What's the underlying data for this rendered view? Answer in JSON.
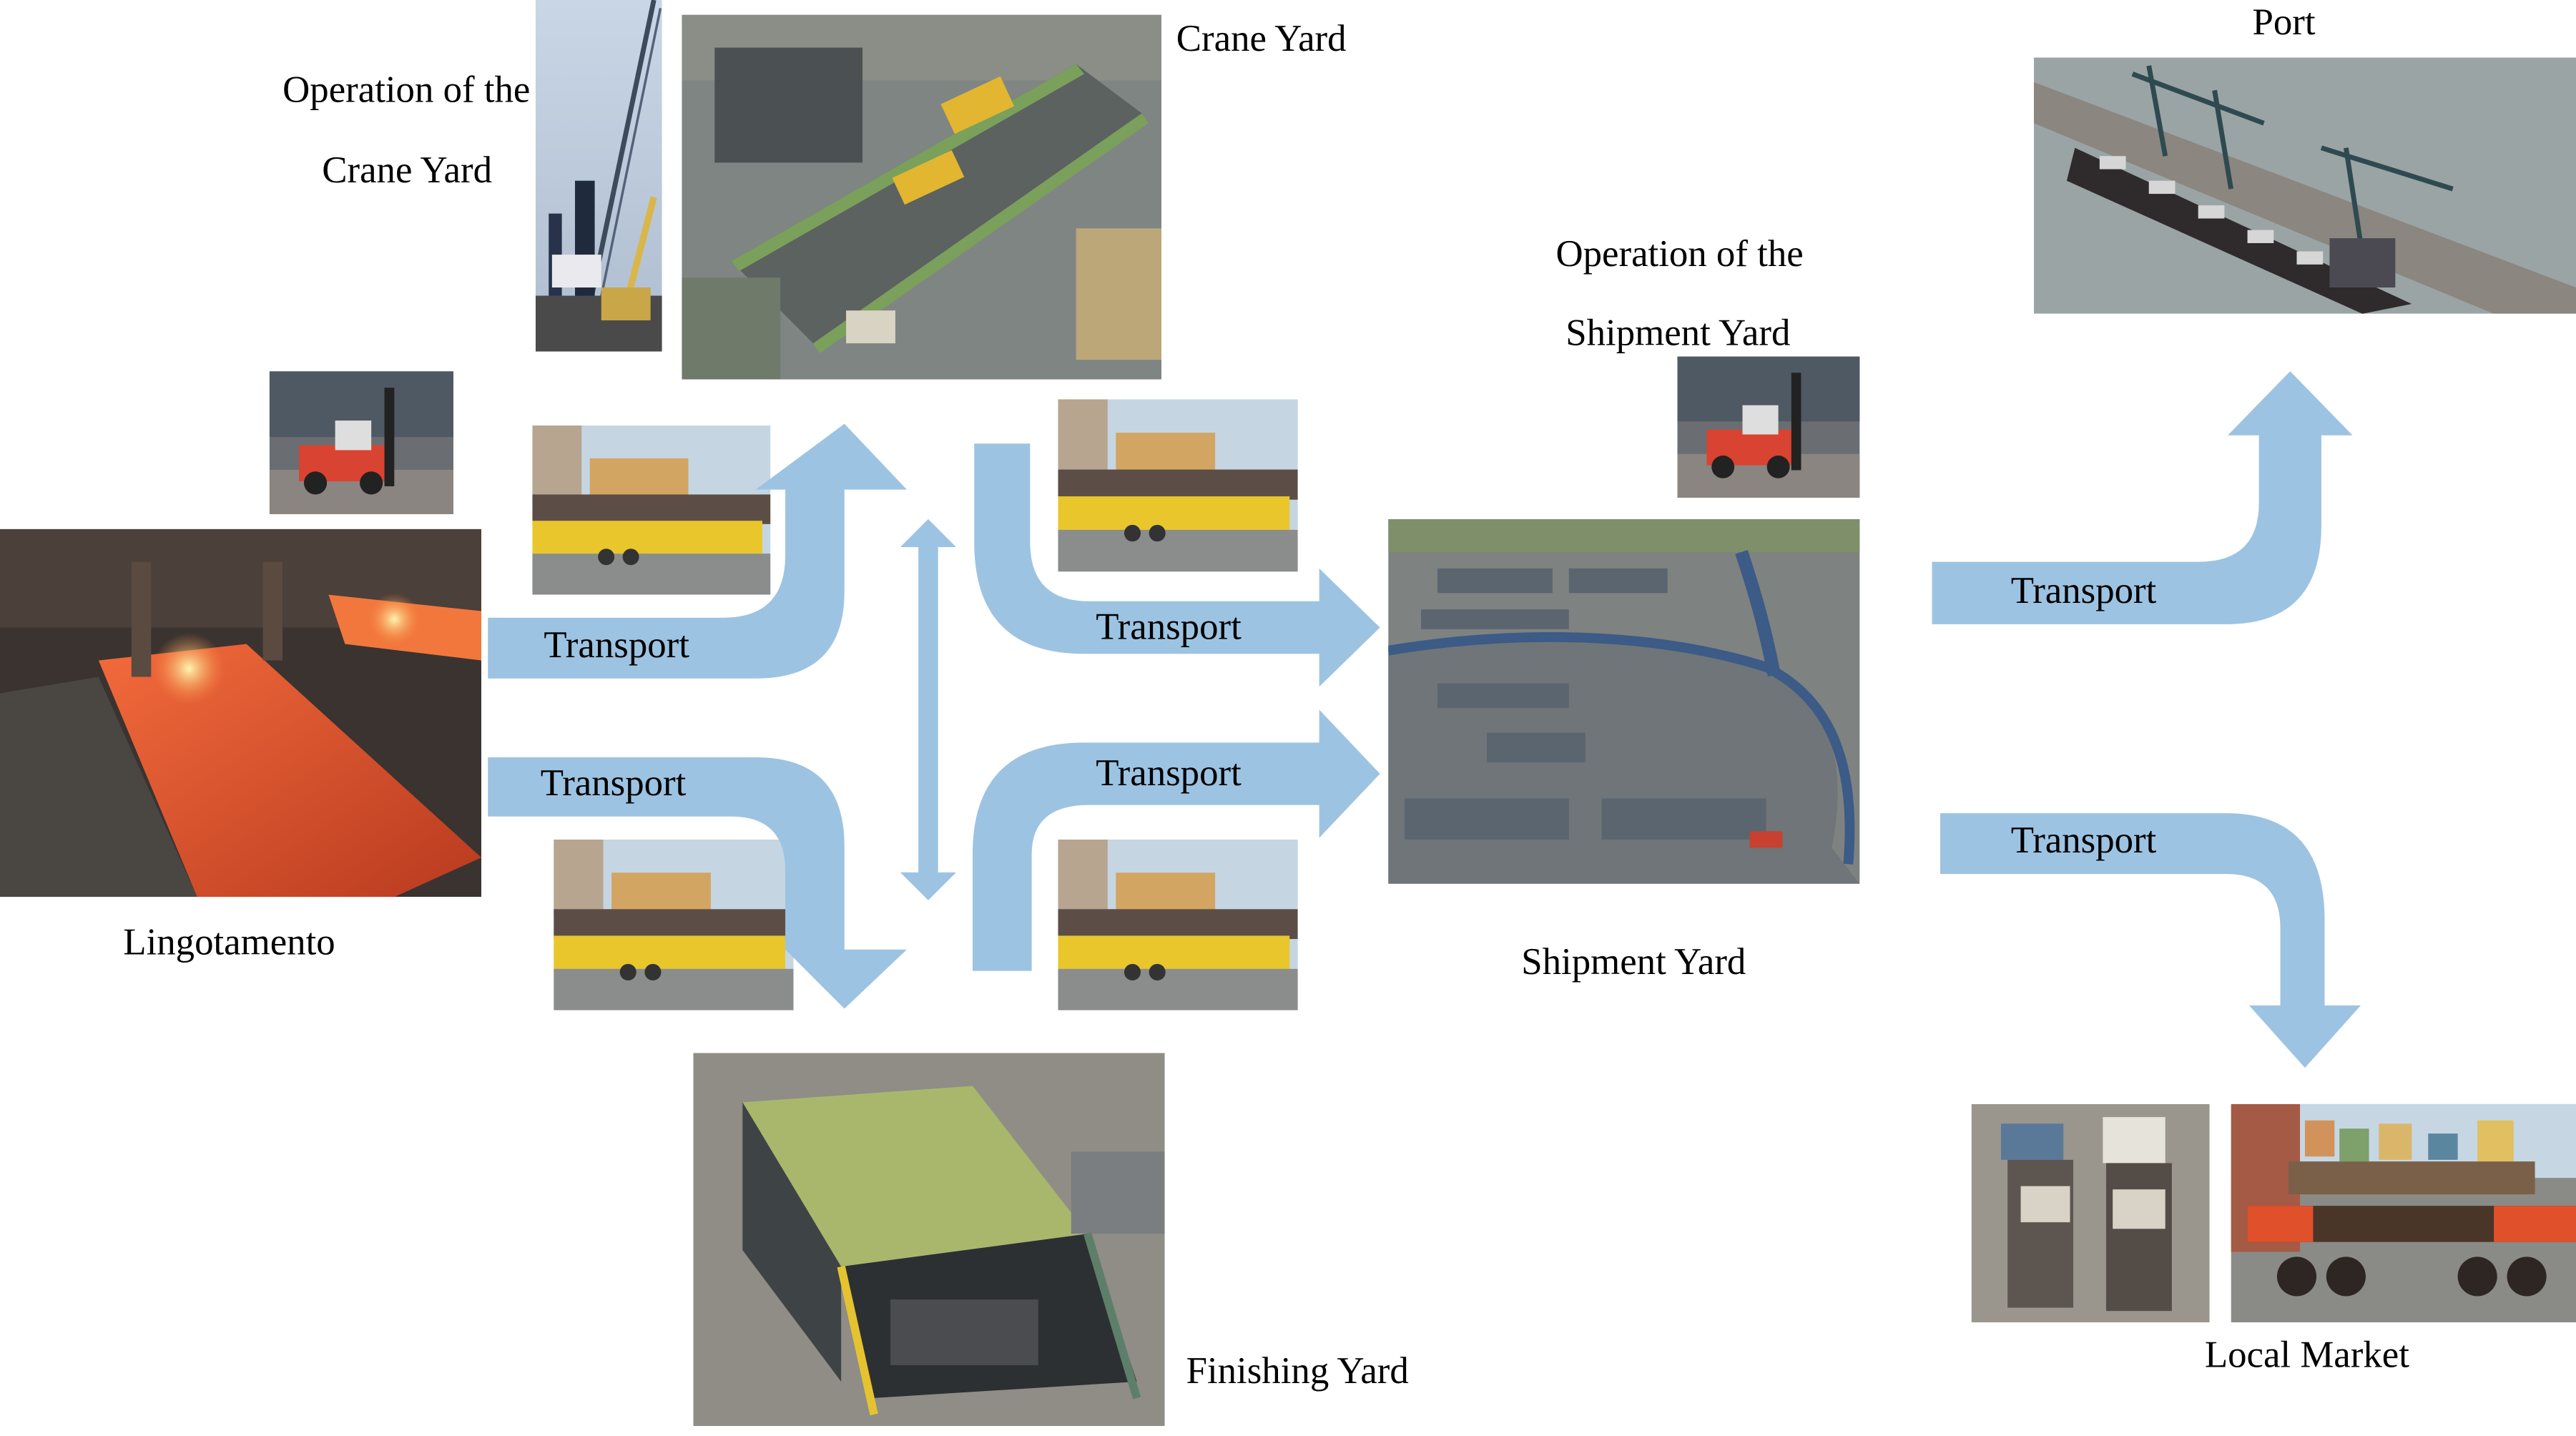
{
  "diagram": {
    "nodes": {
      "lingotamento": {
        "label": "Lingotamento"
      },
      "crane_yard": {
        "label": "Crane Yard"
      },
      "crane_yard_operation": {
        "label_line1": "Operation of the",
        "label_line2": "Crane Yard"
      },
      "finishing_yard": {
        "label": "Finishing Yard"
      },
      "shipment_yard": {
        "label": "Shipment Yard"
      },
      "shipment_yard_operation": {
        "label_line1": "Operation of the",
        "label_line2": "Shipment Yard"
      },
      "port": {
        "label": "Port"
      },
      "local_market": {
        "label": "Local Market"
      }
    },
    "edges": [
      {
        "from": "Lingotamento",
        "to": "Crane Yard",
        "label": "Transport"
      },
      {
        "from": "Lingotamento",
        "to": "Finishing Yard",
        "label": "Transport"
      },
      {
        "from": "Crane Yard",
        "to": "Finishing Yard",
        "label": "",
        "bidirectional": true
      },
      {
        "from": "Crane Yard",
        "to": "Shipment Yard",
        "label": "Transport"
      },
      {
        "from": "Finishing Yard",
        "to": "Shipment Yard",
        "label": "Transport"
      },
      {
        "from": "Shipment Yard",
        "to": "Port",
        "label": "Transport"
      },
      {
        "from": "Shipment Yard",
        "to": "Local Market",
        "label": "Transport"
      }
    ],
    "photos": [
      "crane-photo",
      "crane-yard-aerial-photo",
      "forklift-photo",
      "steel-mill-casting-photo",
      "transport-trailer-photo",
      "finishing-yard-aerial-photo",
      "shipment-yard-aerial-photo",
      "port-ship-photo",
      "trucks-photo",
      "rail-wagon-photo"
    ],
    "arrow_color": "#9dc3e2"
  }
}
